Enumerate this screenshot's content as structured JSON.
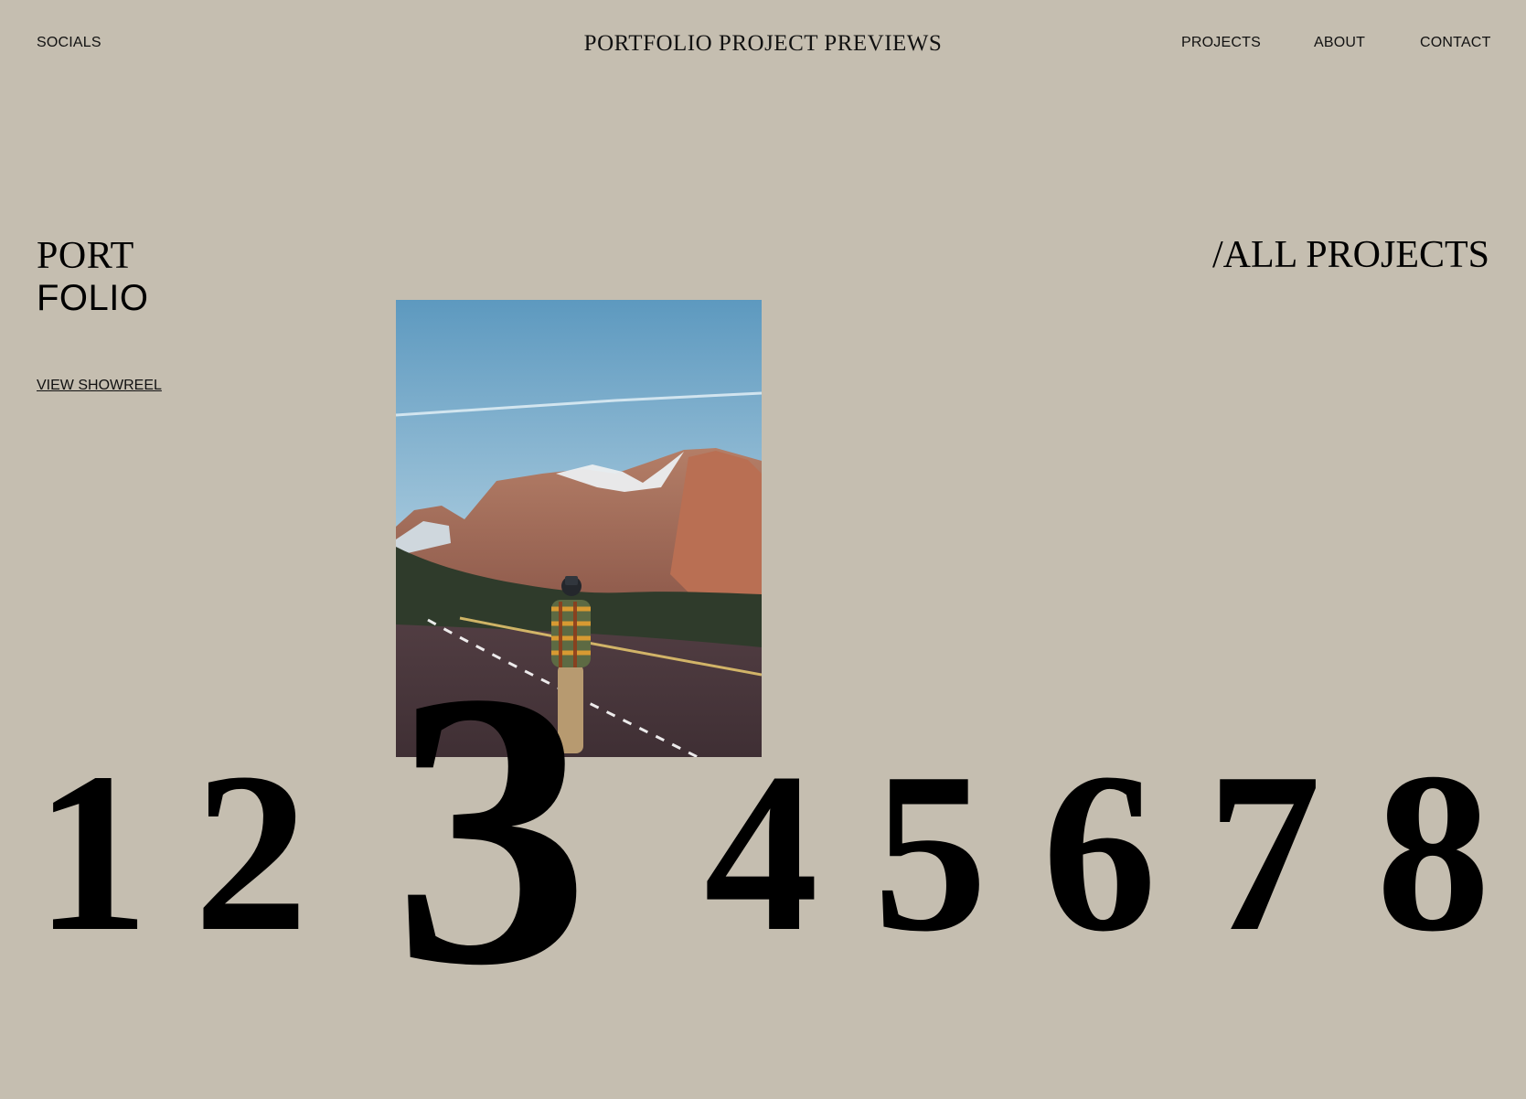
{
  "header": {
    "socials_label": "SOCIALS",
    "title": "PORTFOLIO PROJECT PREVIEWS",
    "nav": {
      "projects": "PROJECTS",
      "about": "ABOUT",
      "contact": "CONTACT"
    }
  },
  "hero": {
    "line_1": "PORT",
    "line_2": "FOLIO",
    "showreel_label": "VIEW SHOWREEL",
    "filter_label": "/ALL PROJECTS"
  },
  "projects": {
    "numbers": [
      "1",
      "2",
      "3",
      "4",
      "5",
      "6",
      "7",
      "8"
    ],
    "active_index": 2
  },
  "colors": {
    "background": "#c5beb0",
    "text": "#000000"
  }
}
